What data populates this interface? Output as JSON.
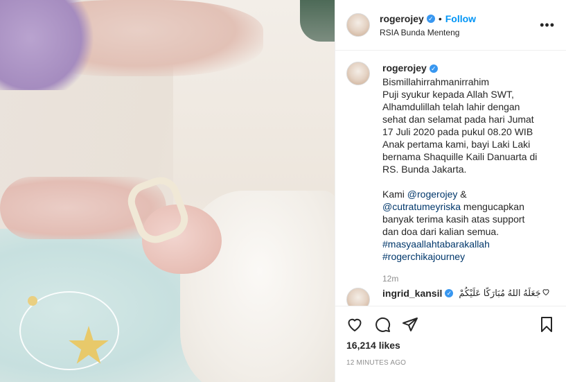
{
  "post": {
    "username": "rogerojey",
    "follow_label": "Follow",
    "dot": "•",
    "location": "RSIA Bunda Menteng",
    "more_label": "•••"
  },
  "caption": {
    "username": "rogerojey",
    "lines": [
      "Bismillahirrahmanirrahim",
      "Puji syukur kepada Allah SWT,",
      "Alhamdulillah telah lahir dengan",
      "sehat dan selamat pada hari Jumat",
      "17 Juli 2020 pada pukul 08.20 WIB",
      "Anak pertama kami, bayi Laki Laki",
      "bernama Shaquille Kaili Danuarta di",
      "RS. Bunda Jakarta."
    ],
    "second_para": {
      "prefix": "Kami ",
      "mention1": "@rogerojey",
      "amp": " &",
      "mention2": "@cutratumeyriska",
      "after_mention2": " mengucapkan",
      "line3": "banyak terima kasih atas support",
      "line4": "dan doa dari kalian semua.",
      "hashtag1": "#masyaallahtabarakallah",
      "hashtag2": "#rogerchikajourney"
    },
    "time_ago": "12m"
  },
  "reply": {
    "username": "ingrid_kansil",
    "text": "جَعَلَهُ اللهُ مُبَارَكًا عَلَيْكُمْ"
  },
  "actions": {
    "icons": [
      "heart-icon",
      "comment-icon",
      "share-icon",
      "bookmark-icon"
    ],
    "likes": "16,214 likes",
    "posted": "12 MINUTES AGO"
  },
  "colors": {
    "accent": "#0095f6",
    "verified": "#3897f0",
    "link": "#00376b",
    "muted": "#8e8e8e"
  }
}
